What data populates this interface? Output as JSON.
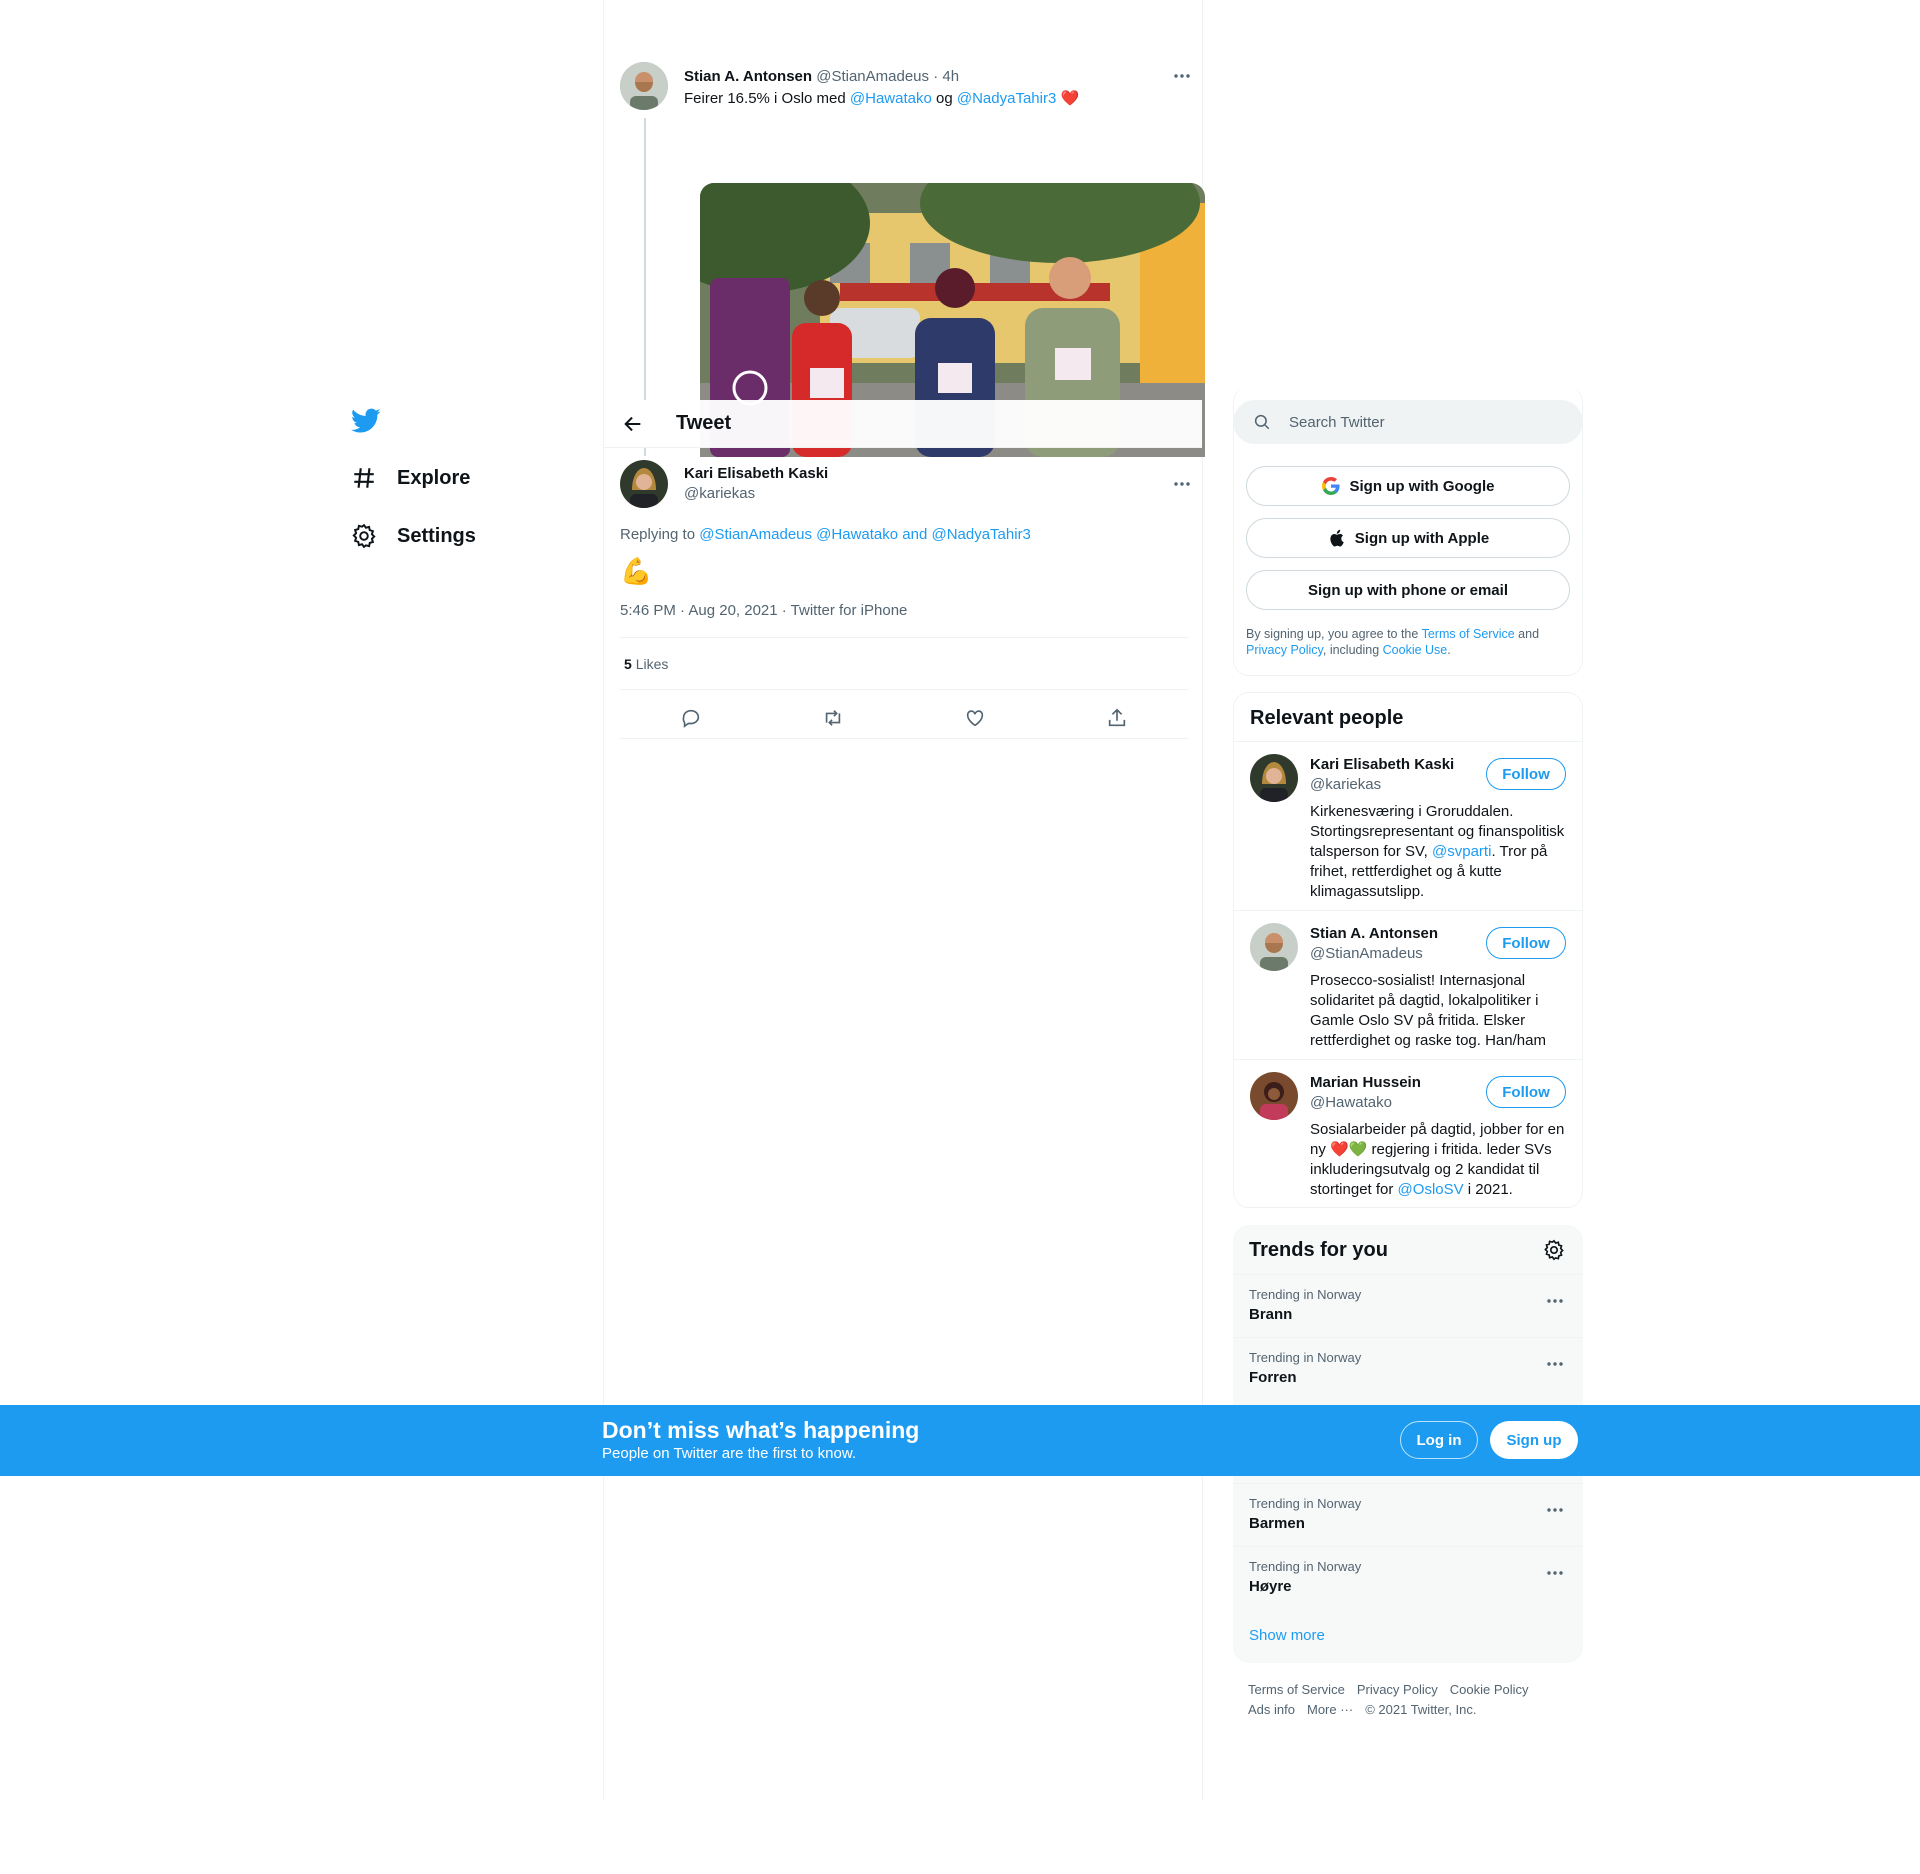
{
  "nav": {
    "items": [
      {
        "label": "Explore",
        "icon": "hashtag-icon"
      },
      {
        "label": "Settings",
        "icon": "gear-icon"
      }
    ]
  },
  "parent_tweet": {
    "name": "Stian A. Antonsen",
    "handle": "@StianAmadeus",
    "time": "· 4h",
    "text_before": "Feirer 16.5% i Oslo med ",
    "mention1": "@Hawatako",
    "text_mid": " og ",
    "mention2": "@NadyaTahir3",
    "heart": "❤️"
  },
  "header": {
    "title": "Tweet"
  },
  "main_tweet": {
    "name": "Kari Elisabeth Kaski",
    "handle": "@kariekas",
    "replying_prefix": "Replying to ",
    "replying_users": "@StianAmadeus @Hawatako and @NadyaTahir3",
    "text": "💪",
    "timestamp": "5:46 PM · Aug 20, 2021 · Twitter for iPhone",
    "likes_count": "5",
    "likes_label": "Likes"
  },
  "search": {
    "placeholder": "Search Twitter"
  },
  "signup": {
    "google": "Sign up with Google",
    "apple": "Sign up with Apple",
    "phone": "Sign up with phone or email",
    "legal_1": "By signing up, you agree to the ",
    "terms": "Terms of Service",
    "legal_2": " and ",
    "privacy": "Privacy Policy",
    "legal_3": ", including ",
    "cookie": "Cookie Use",
    "legal_4": "."
  },
  "relevant": {
    "title": "Relevant people",
    "follow_label": "Follow",
    "people": [
      {
        "name": "Kari Elisabeth Kaski",
        "handle": "@kariekas",
        "bio_1": "Kirkenesværing i Groruddalen. Stortingsrepresentant og finanspolitisk talsperson for SV, ",
        "bio_link": "@svparti",
        "bio_2": ". Tror på frihet, rettferdighet og å kutte klimagassutslipp."
      },
      {
        "name": "Stian A. Antonsen",
        "handle": "@StianAmadeus",
        "bio_1": "Prosecco-sosialist! Internasjonal solidaritet på dagtid, lokalpolitiker i Gamle Oslo SV på fritida. Elsker rettferdighet og raske tog. Han/ham",
        "bio_link": "",
        "bio_2": ""
      },
      {
        "name": "Marian Hussein",
        "handle": "@Hawatako",
        "bio_1": "Sosialarbeider på dagtid, jobber for en ny ❤️💚 regjering i fritida. leder SVs inkluderingsutvalg og 2 kandidat til stortinget for ",
        "bio_link": "@OsloSV",
        "bio_2": " i 2021."
      }
    ]
  },
  "trends": {
    "title": "Trends for you",
    "items": [
      {
        "location": "Trending in Norway",
        "name": "Brann"
      },
      {
        "location": "Trending in Norway",
        "name": "Forren"
      },
      {
        "location": "Trending in Norway",
        "name": "Barmen"
      },
      {
        "location": "Trending in Norway",
        "name": "Høyre"
      }
    ],
    "show_more": "Show more"
  },
  "footer": {
    "terms": "Terms of Service",
    "privacy": "Privacy Policy",
    "cookie": "Cookie Policy",
    "ads": "Ads info",
    "more": "More ···",
    "copyright": "© 2021 Twitter, Inc."
  },
  "bottom_bar": {
    "title": "Don’t miss what’s happening",
    "subtitle": "People on Twitter are the first to know.",
    "login": "Log in",
    "signup": "Sign up"
  },
  "colors": {
    "accent": "#1d9bf0",
    "text": "#0f1419",
    "muted": "#536471"
  }
}
